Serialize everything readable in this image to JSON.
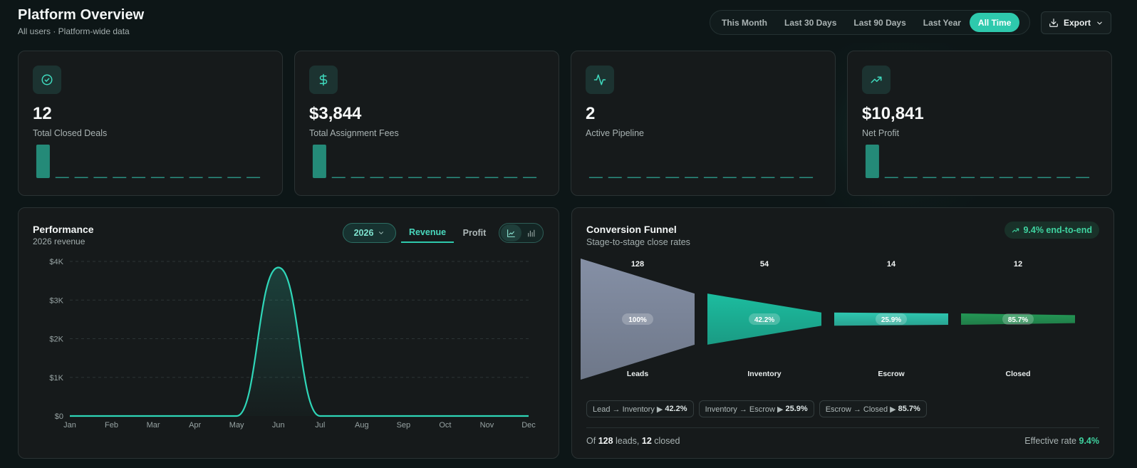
{
  "header": {
    "title": "Platform Overview",
    "subtitle": "All users · Platform-wide data"
  },
  "range": {
    "options": [
      "This Month",
      "Last 30 Days",
      "Last 90 Days",
      "Last Year",
      "All Time"
    ],
    "active": "All Time"
  },
  "export_label": "Export",
  "stats": [
    {
      "value": "12",
      "label": "Total Closed Deals",
      "icon": "check-circle-icon",
      "spark": [
        12,
        0,
        0,
        0,
        0,
        0,
        0,
        0,
        0,
        0,
        0,
        0
      ]
    },
    {
      "value": "$3,844",
      "label": "Total Assignment Fees",
      "icon": "dollar-icon",
      "spark": [
        3844,
        0,
        0,
        0,
        0,
        0,
        0,
        0,
        0,
        0,
        0,
        0
      ]
    },
    {
      "value": "2",
      "label": "Active Pipeline",
      "icon": "activity-icon",
      "spark": [
        0,
        0,
        0,
        0,
        0,
        0,
        0,
        0,
        0,
        0,
        0,
        0
      ]
    },
    {
      "value": "$10,841",
      "label": "Net Profit",
      "icon": "trending-up-icon",
      "spark": [
        10841,
        0,
        0,
        0,
        0,
        0,
        0,
        0,
        0,
        0,
        0,
        0
      ]
    }
  ],
  "performance": {
    "title": "Performance",
    "subtitle": "2026 revenue",
    "year": "2026",
    "tabs": {
      "revenue": "Revenue",
      "profit": "Profit"
    },
    "active_tab": "Revenue"
  },
  "chart_data": {
    "type": "line",
    "categories": [
      "Jan",
      "Feb",
      "Mar",
      "Apr",
      "May",
      "Jun",
      "Jul",
      "Aug",
      "Sep",
      "Oct",
      "Nov",
      "Dec"
    ],
    "values": [
      0,
      0,
      0,
      0,
      0,
      3844,
      0,
      0,
      0,
      0,
      0,
      0
    ],
    "yticks": [
      "$0",
      "$1K",
      "$2K",
      "$3K",
      "$4K"
    ],
    "ylim": [
      0,
      4000
    ],
    "grid": true
  },
  "funnel": {
    "title": "Conversion Funnel",
    "subtitle": "Stage-to-stage close rates",
    "end_to_end": "9.4% end-to-end",
    "stages": [
      {
        "name": "Leads",
        "count": "128",
        "rate": "100%",
        "value": 128,
        "color": "#8b96ad"
      },
      {
        "name": "Inventory",
        "count": "54",
        "rate": "42.2%",
        "value": 54,
        "color": "#1cc5a6"
      },
      {
        "name": "Escrow",
        "count": "14",
        "rate": "25.9%",
        "value": 14,
        "color": "#2fd0b8"
      },
      {
        "name": "Closed",
        "count": "12",
        "rate": "85.7%",
        "value": 12,
        "color": "#249e58"
      }
    ],
    "transitions": [
      {
        "label": "Lead → Inventory ▶",
        "rate": "42.2%"
      },
      {
        "label": "Inventory → Escrow ▶",
        "rate": "25.9%"
      },
      {
        "label": "Escrow → Closed ▶",
        "rate": "85.7%"
      }
    ],
    "footer": {
      "prefix": "Of",
      "leads": "128",
      "mid": "leads,",
      "closed": "12",
      "suffix": "closed",
      "rate_label": "Effective rate",
      "rate": "9.4%"
    }
  }
}
